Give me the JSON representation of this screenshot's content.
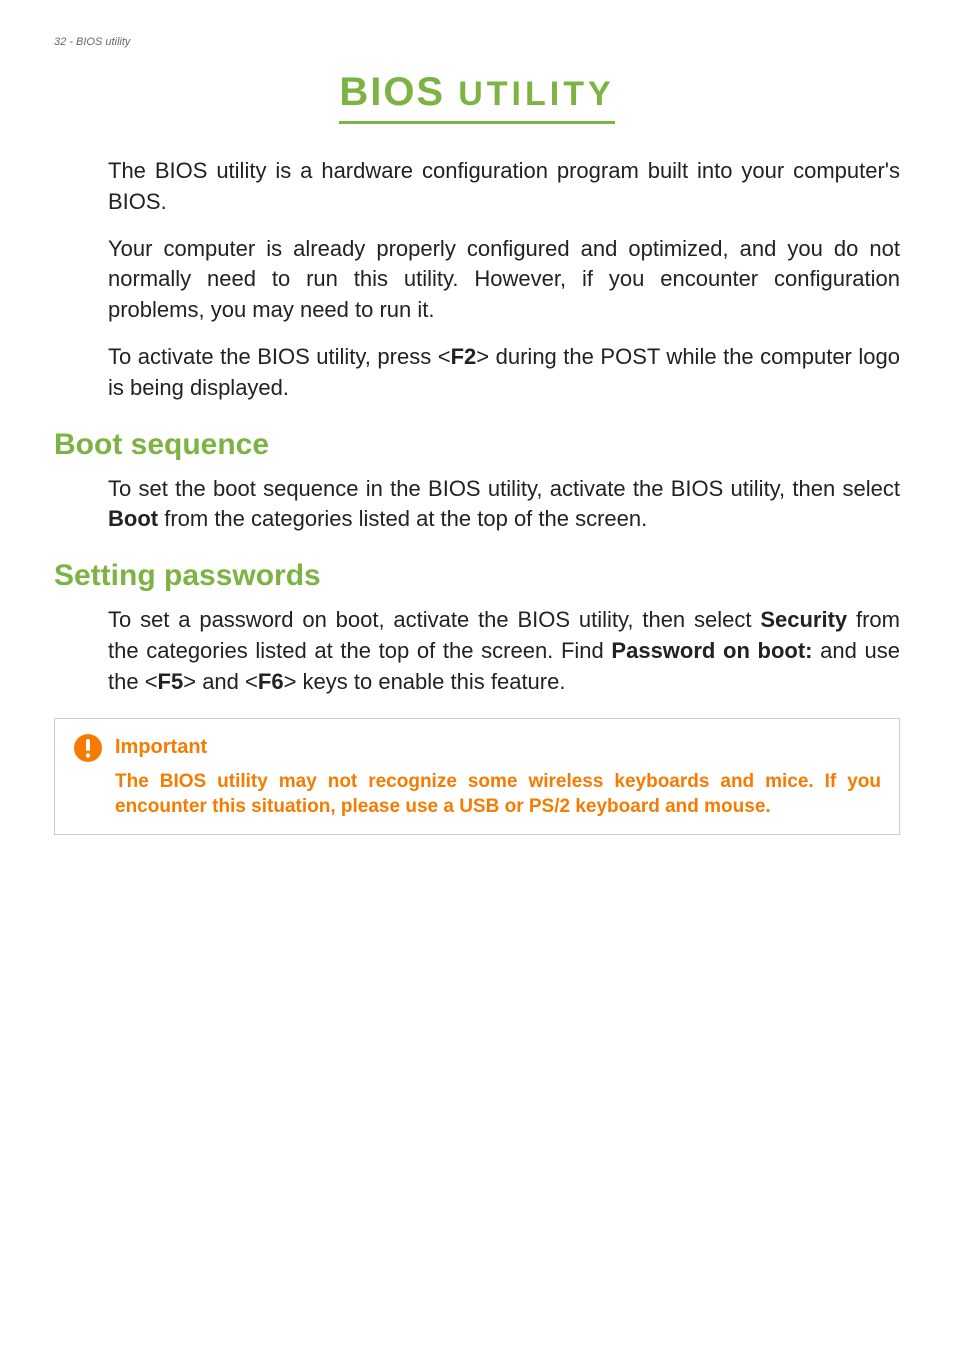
{
  "header": {
    "page_label": "32 - BIOS utility"
  },
  "title": {
    "main": "BIOS",
    "sub": "UTILITY"
  },
  "intro": {
    "p1": "The BIOS utility is a hardware configuration program built into your computer's BIOS.",
    "p2": "Your computer is already properly configured and optimized, and you do not normally need to run this utility. However, if you encounter configuration problems, you may need to run it.",
    "p3_a": "To activate the BIOS utility, press <",
    "p3_key": "F2",
    "p3_b": "> during the POST while the computer logo is being displayed."
  },
  "boot": {
    "heading": "Boot sequence",
    "p1_a": "To set the boot sequence in the BIOS utility, activate the BIOS utility, then select ",
    "p1_bold": "Boot",
    "p1_b": " from the categories listed at the top of the screen."
  },
  "passwords": {
    "heading": "Setting passwords",
    "p1_a": "To set a password on boot, activate the BIOS utility, then select ",
    "p1_bold1": "Security",
    "p1_b": " from the categories listed at the top of the screen. Find ",
    "p1_bold2": "Password on boot:",
    "p1_c": " and use the <",
    "p1_key1": "F5",
    "p1_d": "> and <",
    "p1_key2": "F6",
    "p1_e": "> keys to enable this feature."
  },
  "callout": {
    "title": "Important",
    "body": "The BIOS utility may  not recognize some wireless keyboards and mice. If you encounter this situation, please use a USB or PS/2 keyboard and mouse."
  }
}
